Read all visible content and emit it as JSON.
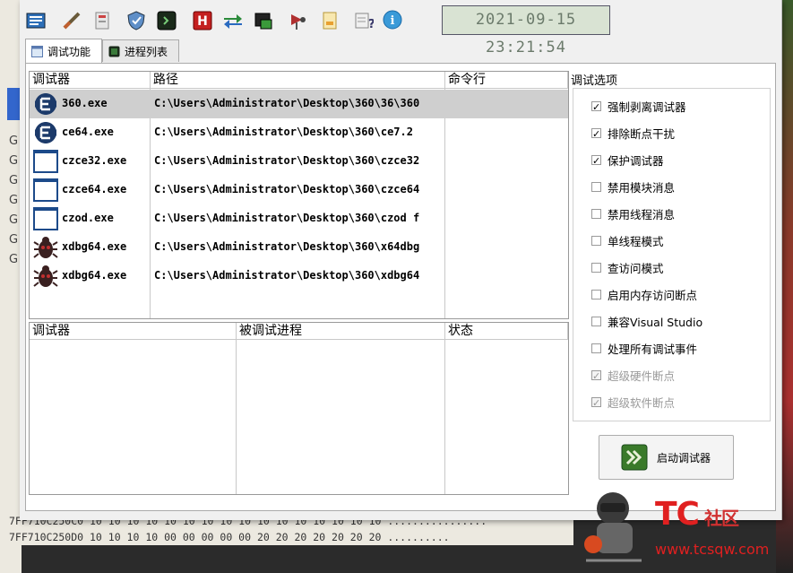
{
  "clock": "2021-09-15 23:21:54",
  "toolbar_icons": [
    "settings-icon",
    "syringe-icon",
    "memory-icon",
    "shield-icon",
    "terminal-icon",
    "h-icon",
    "swap-icon",
    "window-icon",
    "antenna-icon",
    "document-icon",
    "help-icon",
    "info-icon"
  ],
  "tabs": [
    {
      "label": "调试功能",
      "active": true
    },
    {
      "label": "进程列表",
      "active": false
    }
  ],
  "debugger_table": {
    "headers": [
      "调试器",
      "路径",
      "命令行"
    ],
    "rows": [
      {
        "name": "360.exe",
        "path": "C:\\Users\\Administrator\\Desktop\\360\\36\\360",
        "icon": "cheat-engine-icon",
        "selected": true
      },
      {
        "name": "ce64.exe",
        "path": "C:\\Users\\Administrator\\Desktop\\360\\ce7.2",
        "icon": "cheat-engine-icon",
        "selected": false
      },
      {
        "name": "czce32.exe",
        "path": "C:\\Users\\Administrator\\Desktop\\360\\czce32",
        "icon": "window-icon",
        "selected": false
      },
      {
        "name": "czce64.exe",
        "path": "C:\\Users\\Administrator\\Desktop\\360\\czce64",
        "icon": "window-icon",
        "selected": false
      },
      {
        "name": "czod.exe",
        "path": "C:\\Users\\Administrator\\Desktop\\360\\czod f",
        "icon": "window-icon",
        "selected": false
      },
      {
        "name": "xdbg64.exe",
        "path": "C:\\Users\\Administrator\\Desktop\\360\\x64dbg",
        "icon": "bug-icon",
        "selected": false
      },
      {
        "name": "xdbg64.exe",
        "path": "C:\\Users\\Administrator\\Desktop\\360\\xdbg64",
        "icon": "bug-icon",
        "selected": false
      }
    ]
  },
  "session_table": {
    "headers": [
      "调试器",
      "被调试进程",
      "状态"
    ]
  },
  "options": {
    "group_label": "调试选项",
    "items": [
      {
        "label": "强制剥离调试器",
        "checked": true,
        "disabled": false
      },
      {
        "label": "排除断点干扰",
        "checked": true,
        "disabled": false
      },
      {
        "label": "保护调试器",
        "checked": true,
        "disabled": false
      },
      {
        "label": "禁用模块消息",
        "checked": false,
        "disabled": false
      },
      {
        "label": "禁用线程消息",
        "checked": false,
        "disabled": false
      },
      {
        "label": "单线程模式",
        "checked": false,
        "disabled": false
      },
      {
        "label": "查访问模式",
        "checked": false,
        "disabled": false
      },
      {
        "label": "启用内存访问断点",
        "checked": false,
        "disabled": false
      },
      {
        "label": "兼容Visual Studio",
        "checked": false,
        "disabled": false
      },
      {
        "label": "处理所有调试事件",
        "checked": false,
        "disabled": false
      },
      {
        "label": "超级硬件断点",
        "checked": true,
        "disabled": true
      },
      {
        "label": "超级软件断点",
        "checked": true,
        "disabled": true
      }
    ]
  },
  "start_button": "启动调试器",
  "background": {
    "hex_rows": [
      "7FF710C250C0 10 10 10 10 10 10 10 10 10 10 10 10 10 10 10 10 ................",
      "7FF710C250D0 10 10 10 10 00 00 00 00 00 20 20 20 20 20 20 20 .........."
    ],
    "left_chars": [
      "G",
      "G",
      "G",
      "G",
      "G",
      "G",
      "G"
    ]
  },
  "watermark": {
    "brand": "TC",
    "brand_suffix": "社区",
    "url": "www.tcsqw.com"
  }
}
